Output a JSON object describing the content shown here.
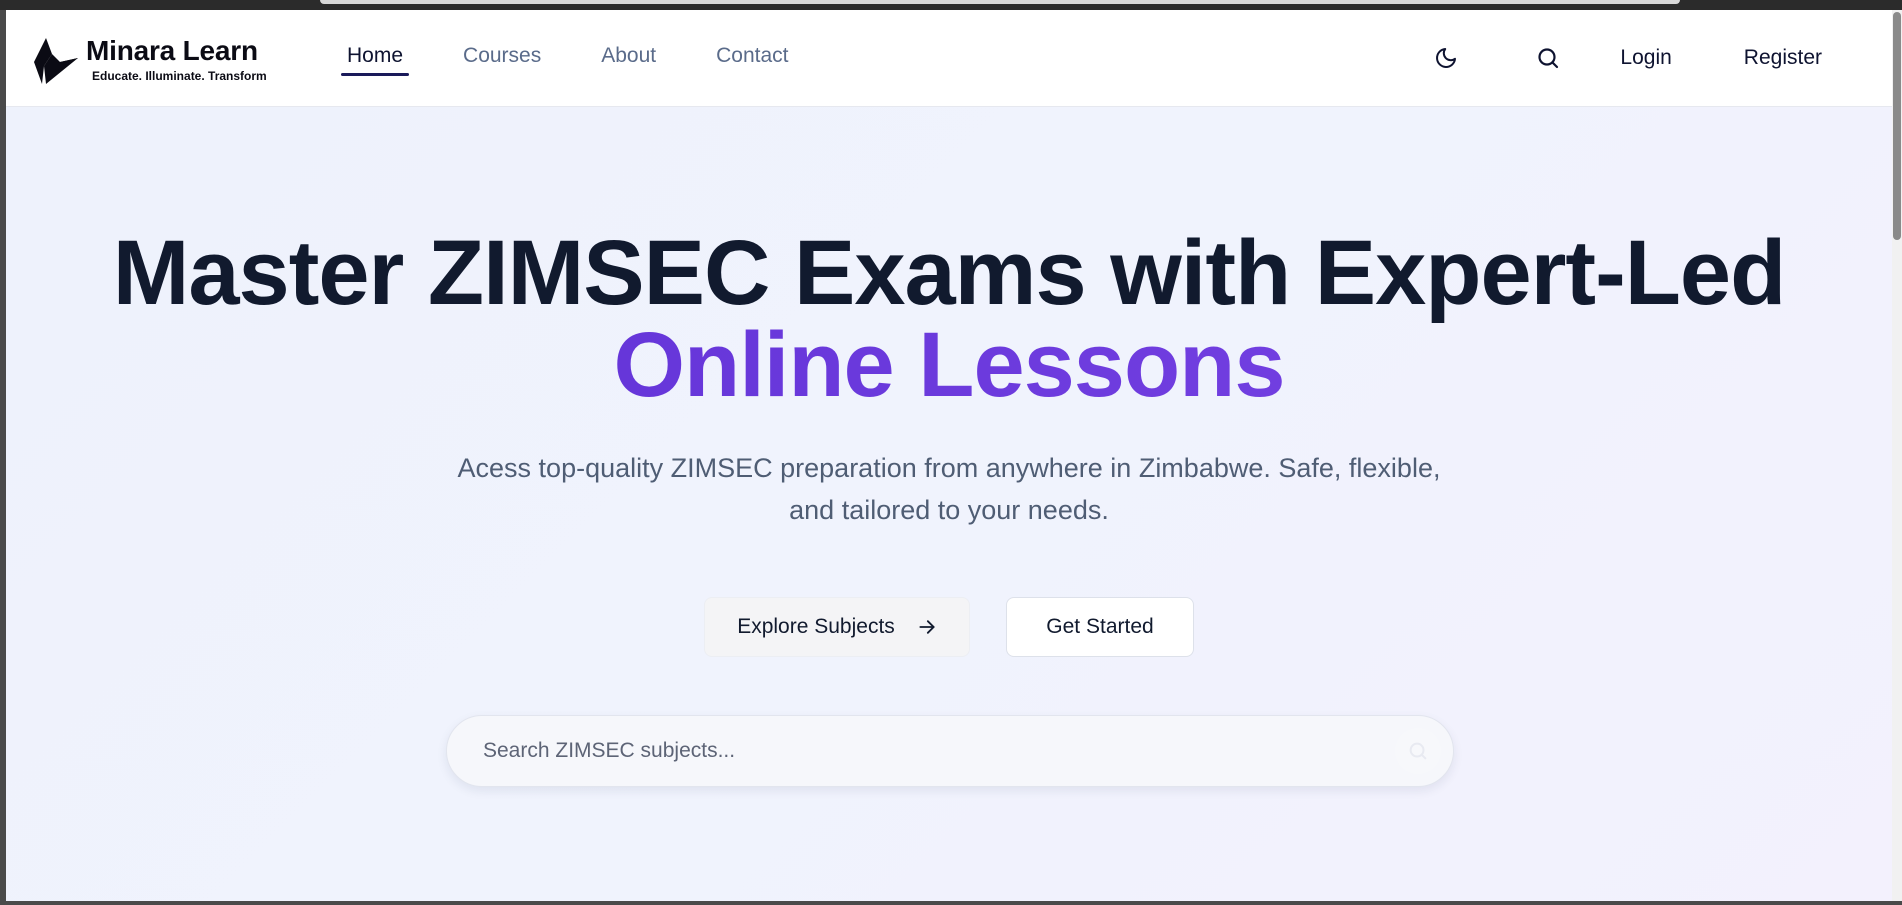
{
  "brand": {
    "name": "Minara Learn",
    "tagline": "Educate. Illuminate. Transform"
  },
  "nav": {
    "items": [
      {
        "label": "Home",
        "active": true
      },
      {
        "label": "Courses",
        "active": false
      },
      {
        "label": "About",
        "active": false
      },
      {
        "label": "Contact",
        "active": false
      }
    ],
    "login_label": "Login",
    "register_label": "Register",
    "theme_icon": "moon-icon",
    "search_icon": "search-icon"
  },
  "hero": {
    "title_line1": "Master ZIMSEC Exams with Expert-Led",
    "title_line2": "Online Lessons",
    "subtitle": "Acess top-quality ZIMSEC preparation from anywhere in Zimbabwe. Safe, flexible, and tailored to your needs.",
    "explore_label": "Explore Subjects",
    "start_label": "Get Started",
    "search_placeholder": "Search ZIMSEC subjects..."
  },
  "colors": {
    "accent": "#6336d6",
    "heading": "#111a2e",
    "nav_text": "#5a6b8a"
  }
}
